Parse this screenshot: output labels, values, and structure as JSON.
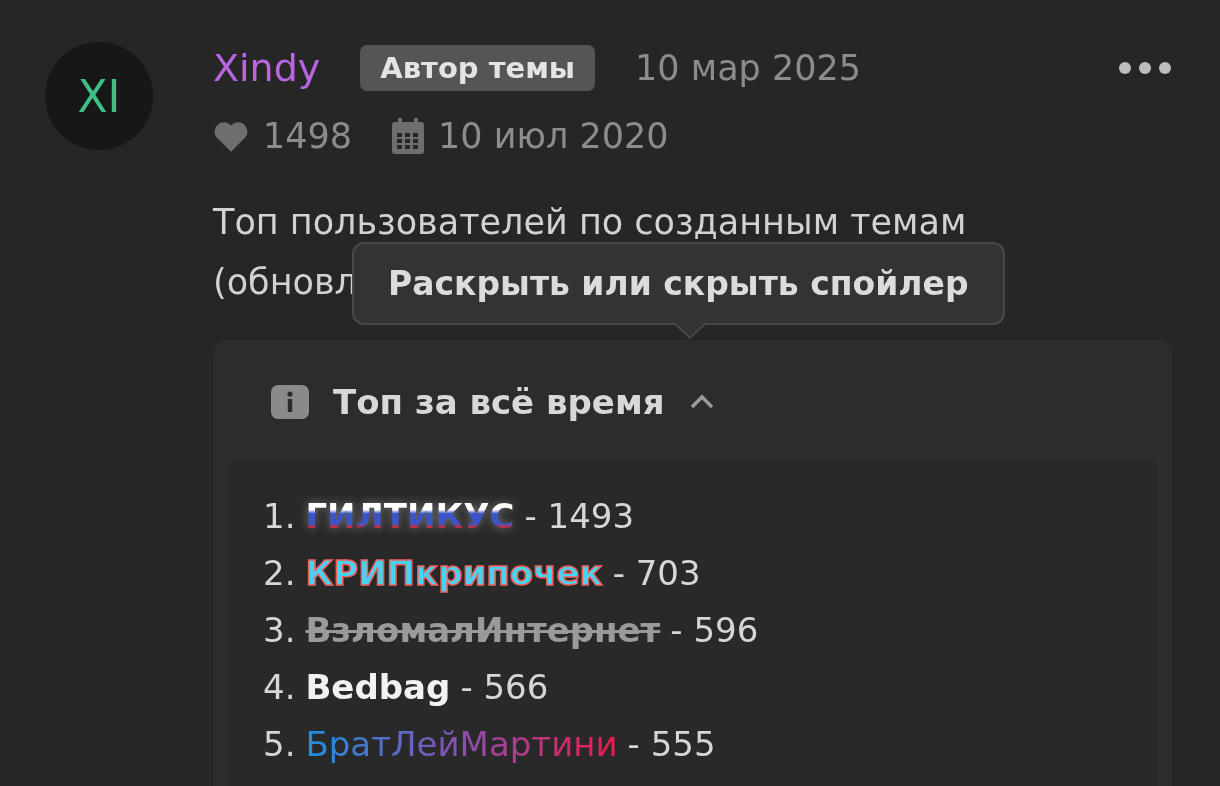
{
  "post": {
    "avatar": {
      "initials": "XI"
    },
    "author": "Xindy",
    "badge": "Автор темы",
    "date": "10 мар 2025",
    "likes": "1498",
    "joined": "10 июл 2020",
    "text_lines": [
      "Топ пользователей по созданным темам",
      "(обновл"
    ],
    "tooltip": "Раскрыть или скрыть спойлер",
    "spoiler": {
      "title": "Топ за всё время",
      "expanded": true,
      "items": [
        {
          "rank": "1.",
          "name": "ГИЛТИКУС",
          "count": "- 1493",
          "kind": "flag"
        },
        {
          "rank": "2.",
          "name": "КРИПкрипочек",
          "count": "- 703",
          "kind": "outlined"
        },
        {
          "rank": "3.",
          "name": "ВзломалИнтернет",
          "count": "- 596",
          "kind": "struck"
        },
        {
          "rank": "4.",
          "name": "Bedbag",
          "count": "- 566",
          "kind": "bold"
        },
        {
          "rank": "5.",
          "name": "БратЛейМартини",
          "count": "- 555",
          "kind": "gradient"
        }
      ]
    }
  }
}
